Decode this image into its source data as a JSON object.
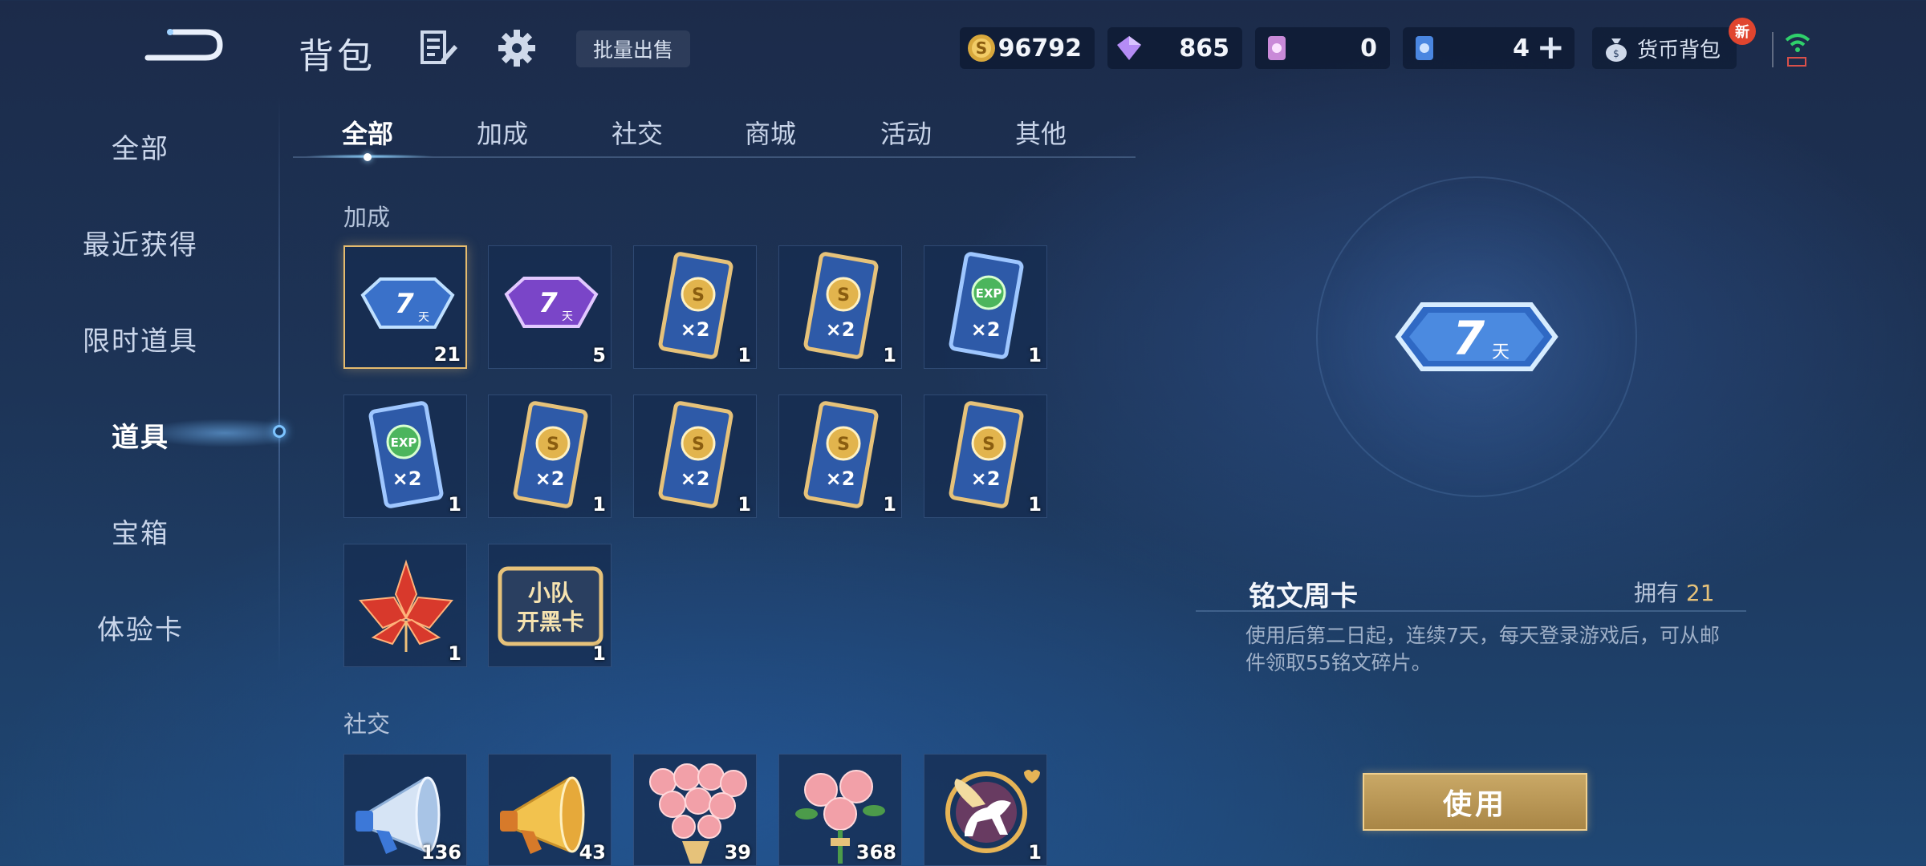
{
  "header": {
    "title": "背包",
    "batch_sell_label": "批量出售",
    "wallet_label": "货币背包",
    "new_badge": "新"
  },
  "currencies": [
    {
      "icon": "gold-coin-icon",
      "value": "96792"
    },
    {
      "icon": "diamond-icon",
      "value": "865"
    },
    {
      "icon": "pink-voucher-icon",
      "value": "0"
    },
    {
      "icon": "blue-voucher-icon",
      "value": "4"
    }
  ],
  "sidebar": {
    "items": [
      {
        "label": "全部"
      },
      {
        "label": "最近获得"
      },
      {
        "label": "限时道具"
      },
      {
        "label": "道具",
        "active": true
      },
      {
        "label": "宝箱"
      },
      {
        "label": "体验卡"
      }
    ]
  },
  "tabs": [
    {
      "label": "全部",
      "active": true
    },
    {
      "label": "加成"
    },
    {
      "label": "社交"
    },
    {
      "label": "商城"
    },
    {
      "label": "活动"
    },
    {
      "label": "其他"
    }
  ],
  "sections": {
    "bonus": {
      "label": "加成",
      "items": [
        {
          "icon": "blue-7day-card-icon",
          "qty": "21",
          "selected": true
        },
        {
          "icon": "purple-7day-card-icon",
          "qty": "5"
        },
        {
          "icon": "gold-x2-card-icon",
          "qty": "1"
        },
        {
          "icon": "gold-x2-card-icon",
          "qty": "1"
        },
        {
          "icon": "exp-x2-card-icon",
          "qty": "1"
        },
        {
          "icon": "exp-x2-card-icon",
          "qty": "1"
        },
        {
          "icon": "gold-x2-card-icon",
          "qty": "1"
        },
        {
          "icon": "gold-x2-card-icon",
          "qty": "1"
        },
        {
          "icon": "gold-x2-card-icon",
          "qty": "1"
        },
        {
          "icon": "gold-x2-card-icon",
          "qty": "1"
        },
        {
          "icon": "red-maple-leaf-icon",
          "qty": "1"
        },
        {
          "icon": "squad-team-card-icon",
          "qty": "1",
          "line1": "小队",
          "line2": "开黑卡"
        }
      ]
    },
    "social": {
      "label": "社交",
      "items": [
        {
          "icon": "silver-megaphone-icon",
          "qty": "136"
        },
        {
          "icon": "gold-megaphone-icon",
          "qty": "43"
        },
        {
          "icon": "rose-bouquet-icon",
          "qty": "39"
        },
        {
          "icon": "rose-bunch-icon",
          "qty": "368"
        },
        {
          "icon": "pegasus-icon",
          "qty": "1"
        }
      ]
    }
  },
  "detail": {
    "name": "铭文周卡",
    "owned_label": "拥有",
    "owned_count": "21",
    "description": "使用后第二日起，连续7天，每天登录游戏后，可从邮件领取55铭文碎片。",
    "use_label": "使用",
    "icon_text": "7",
    "icon_subtext": "天"
  },
  "colors": {
    "accent_gold": "#e6c27a",
    "selected_border": "#e5bb6e",
    "background_top": "#1c2b4a",
    "background_bottom": "#1f4774"
  }
}
